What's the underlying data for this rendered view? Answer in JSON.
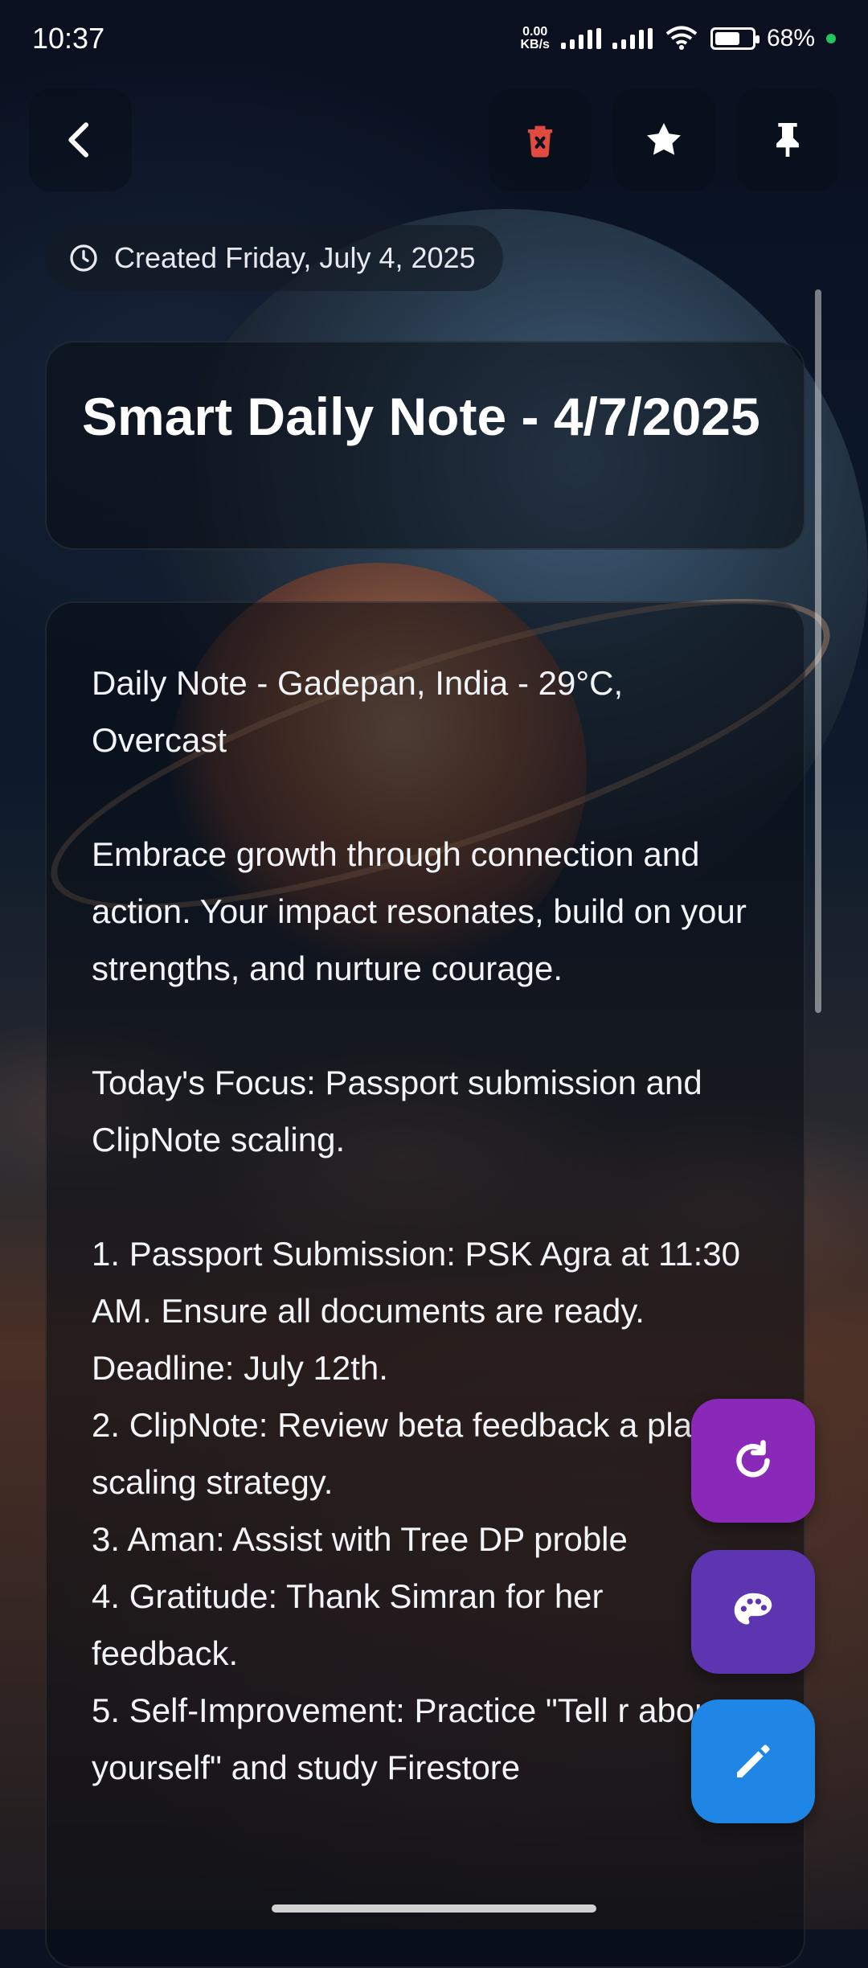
{
  "status_bar": {
    "time": "10:37",
    "net_speed_value": "0.00",
    "net_speed_unit": "KB/s",
    "battery": "68%",
    "battery_level": 0.68
  },
  "toolbar": {
    "back_icon": "chevron-left-icon",
    "delete_icon": "trash-icon",
    "favorite_icon": "star-icon",
    "pin_icon": "pin-icon",
    "delete_color": "#e04a3f"
  },
  "note": {
    "created_label": "Created Friday, July 4, 2025",
    "title": "Smart Daily Note - 4/7/2025",
    "body": {
      "header": "Daily Note - Gadepan, India - 29°C, Overcast",
      "intro": "Embrace growth through connection and action. Your impact resonates, build on your strengths, and nurture courage.",
      "focus": "Today's Focus: Passport submission and ClipNote scaling.",
      "items": [
        "1. Passport Submission: PSK Agra at 11:30 AM. Ensure all documents are ready. Deadline: July 12th.",
        "2. ClipNote: Review beta feedback a plan scaling strategy.",
        "3. Aman: Assist with Tree DP proble",
        "4. Gratitude: Thank Simran for her feedback.",
        "5. Self-Improvement: Practice \"Tell r about yourself\" and study Firestore"
      ]
    }
  },
  "fabs": {
    "refresh_icon": "refresh-icon",
    "palette_icon": "palette-icon",
    "edit_icon": "pencil-icon",
    "refresh_color": "#8a28b8",
    "palette_color": "#5d35b0",
    "edit_color": "#1f86e6"
  }
}
